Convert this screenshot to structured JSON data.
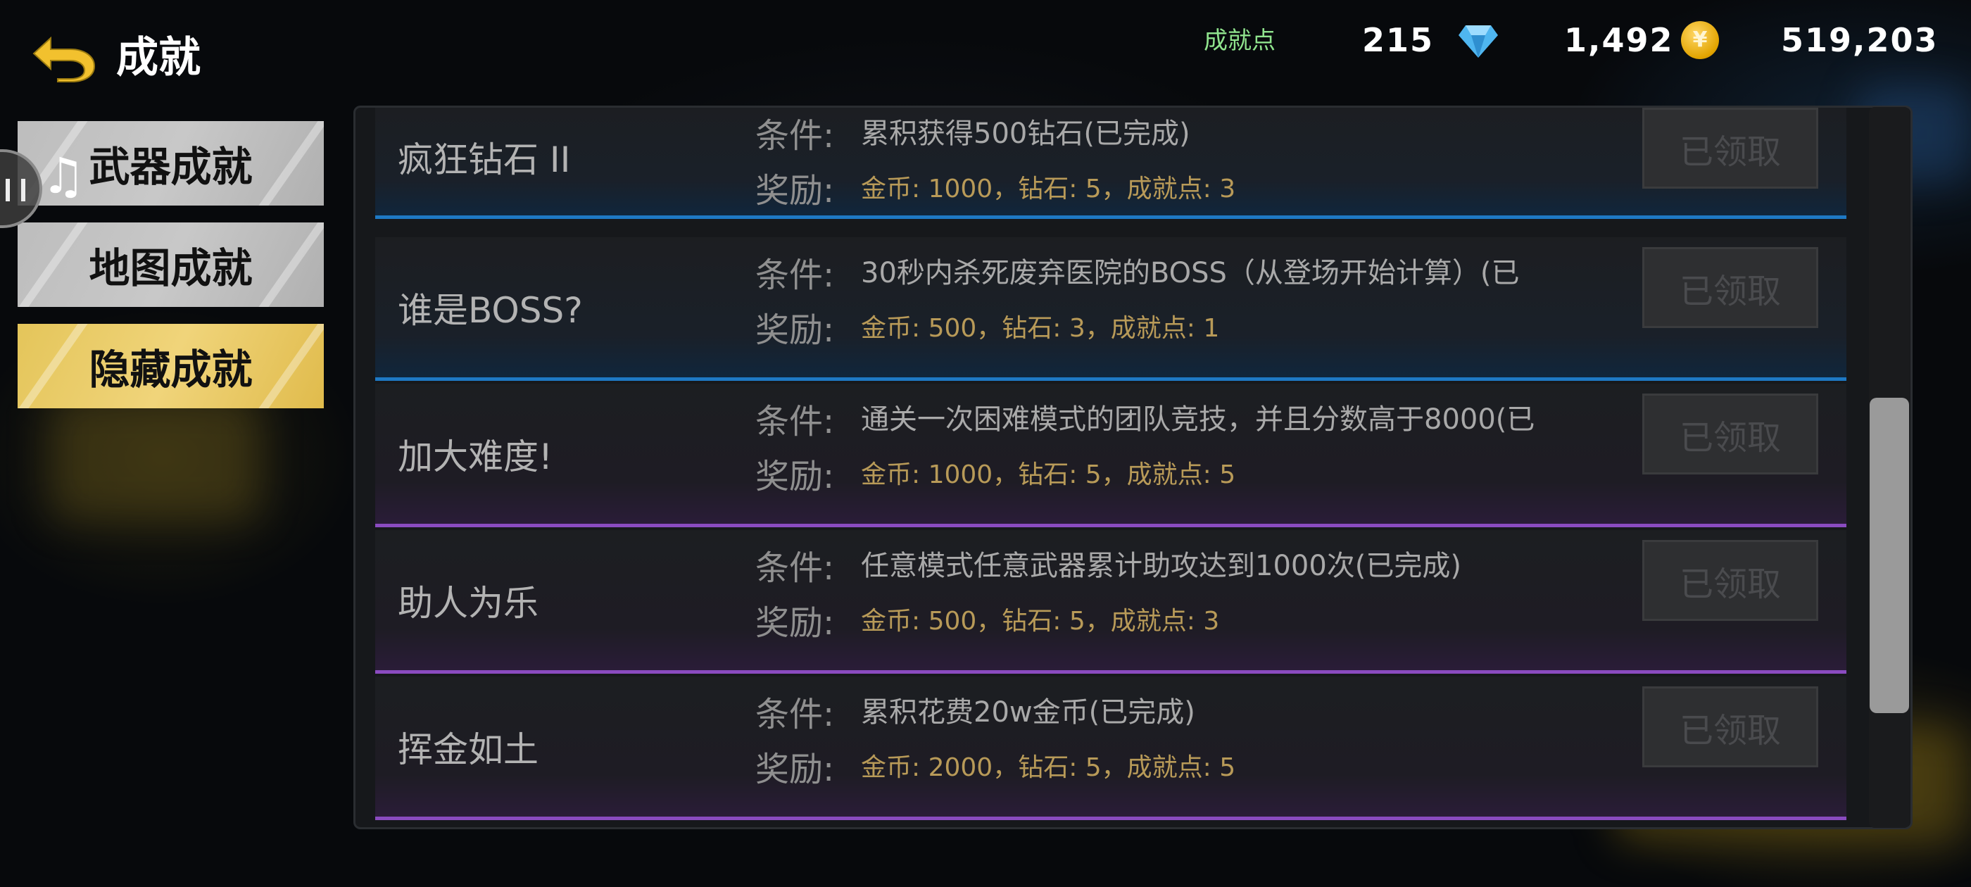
{
  "header": {
    "title": "成就",
    "back_icon": "back-arrow-icon"
  },
  "currency": {
    "points_label": "成就点",
    "points_value": "215",
    "diamonds_value": "1,492",
    "gold_value": "519,203",
    "coin_symbol": "¥",
    "colors": {
      "points_label": "#8fe38d",
      "coin": "#e2a400",
      "diamond": "#4fb6f0"
    }
  },
  "tabs": [
    {
      "label": "武器成就",
      "active": false
    },
    {
      "label": "地图成就",
      "active": false
    },
    {
      "label": "隐藏成就",
      "active": true
    }
  ],
  "tab_colors": {
    "inactive": "#c0c0c0",
    "active": "#f0d47a"
  },
  "list": {
    "condition_label": "条件:",
    "reward_label": "奖励:",
    "items": [
      {
        "name": "疯狂钻石 II",
        "condition": "累积获得500钻石(已完成)",
        "reward": "金币: 1000，钻石: 5，成就点: 3",
        "button": "已领取",
        "accent": "#1e79c4"
      },
      {
        "name": "谁是BOSS?",
        "condition": "30秒内杀死废弃医院的BOSS（从登场开始计算）(已",
        "reward": "金币: 500，钻石: 3，成就点: 1",
        "button": "已领取",
        "accent": "#1e79c4"
      },
      {
        "name": "加大难度!",
        "condition": "通关一次困难模式的团队竞技，并且分数高于8000(已",
        "reward": "金币: 1000，钻石: 5，成就点: 5",
        "button": "已领取",
        "accent": "#8a4bc0"
      },
      {
        "name": "助人为乐",
        "condition": "任意模式任意武器累计助攻达到1000次(已完成)",
        "reward": "金币: 500，钻石: 5，成就点: 3",
        "button": "已领取",
        "accent": "#8a4bc0"
      },
      {
        "name": "挥金如土",
        "condition": "累积花费20w金币(已完成)",
        "reward": "金币: 2000，钻石: 5，成就点: 5",
        "button": "已领取",
        "accent": "#8a4bc0"
      }
    ]
  }
}
